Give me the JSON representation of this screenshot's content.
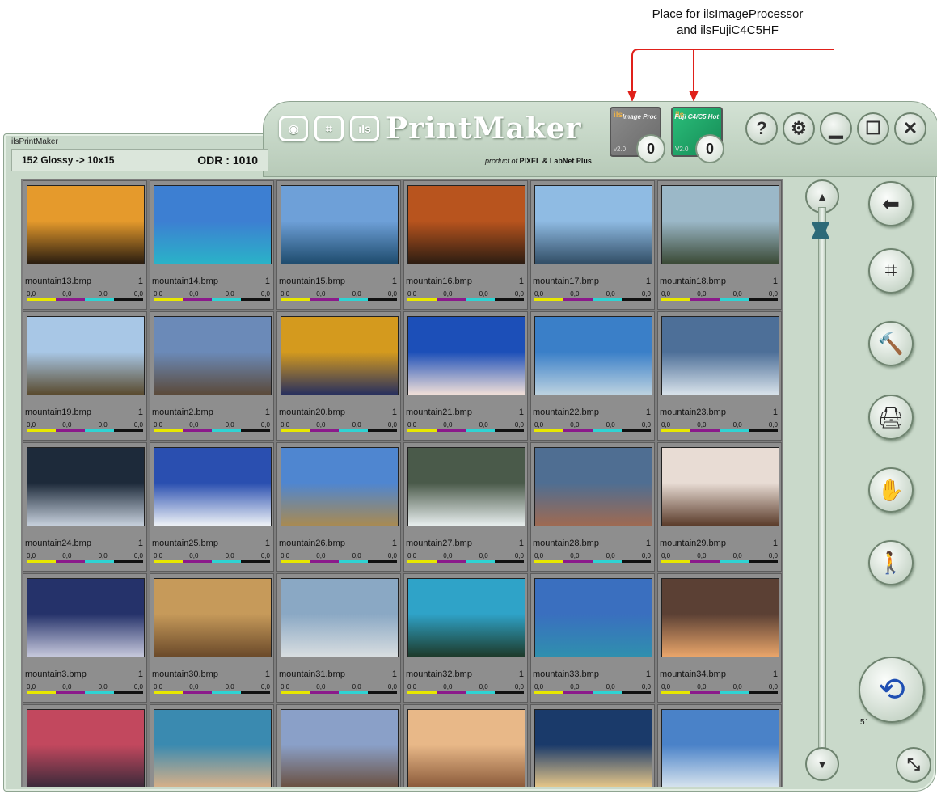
{
  "annotation": {
    "line1": "Place for ilsImageProcessor",
    "line2": "and ilsFujiC4C5HF",
    "arrow_color": "#e0201a"
  },
  "window": {
    "label": "ilsPrintMaker",
    "info_left": "152 Glossy -> 10x15",
    "info_right": "ODR : 1010"
  },
  "header": {
    "logo_box1": "◉",
    "logo_box2": "⌗",
    "logo_box3": "ils",
    "app_name": "PrintMaker",
    "credit_prefix": "product of",
    "credit_brands": "PIXEL & LabNet Plus"
  },
  "plugins": [
    {
      "tag": "ils",
      "name": "Image Proc",
      "version": "v2.0",
      "count": "0",
      "color": "#7a7a7a"
    },
    {
      "tag": "ils",
      "name": "Fuji C4/C5 Hot",
      "version": "V2.0",
      "count": "0",
      "color": "#1fa767"
    }
  ],
  "title_buttons": [
    {
      "name": "help-button",
      "glyph": "?"
    },
    {
      "name": "settings-button",
      "glyph": "⚙"
    },
    {
      "name": "minimize-button",
      "glyph": "▁"
    },
    {
      "name": "maximize-button",
      "glyph": "☐"
    },
    {
      "name": "close-button",
      "glyph": "✕"
    }
  ],
  "side_tools": [
    {
      "name": "back-button",
      "icon": "back-arrow-icon",
      "glyph": "⬅"
    },
    {
      "name": "crop-button",
      "icon": "crop-icon",
      "glyph": "⌗"
    },
    {
      "name": "tools-button",
      "icon": "hammer-icon",
      "glyph": "🔨"
    },
    {
      "name": "printer-button",
      "icon": "printer-icon",
      "glyph": "🖨"
    },
    {
      "name": "color-button",
      "icon": "color-hand-icon",
      "glyph": "✋"
    },
    {
      "name": "walk-button",
      "icon": "person-walking-icon",
      "glyph": "🚶"
    }
  ],
  "print_queue": {
    "count": "51",
    "glyph": "⟲"
  },
  "resize_glyph": "⤡",
  "scroll": {
    "up": "▲",
    "down": "▼"
  },
  "cell_defaults": {
    "qty": "1",
    "corrections": [
      "0,0",
      "0,0",
      "0,0",
      "0,0"
    ],
    "bar_colors": [
      "#e8e800",
      "#8b1a8b",
      "#2fd3d3",
      "#111111"
    ]
  },
  "thumbnails": [
    {
      "name": "mountain13.bmp",
      "qty": "1",
      "c1": "#e59a2c",
      "c2": "#2a1d10"
    },
    {
      "name": "mountain14.bmp",
      "qty": "1",
      "c1": "#3d7fd2",
      "c2": "#2ab2c8"
    },
    {
      "name": "mountain15.bmp",
      "qty": "1",
      "c1": "#6ea0d8",
      "c2": "#1f4c6e"
    },
    {
      "name": "mountain16.bmp",
      "qty": "1",
      "c1": "#b8541e",
      "c2": "#2d1d12"
    },
    {
      "name": "mountain17.bmp",
      "qty": "1",
      "c1": "#8fbbe3",
      "c2": "#324e66"
    },
    {
      "name": "mountain18.bmp",
      "qty": "1",
      "c1": "#9bb8c8",
      "c2": "#3b4a36"
    },
    {
      "name": "mountain19.bmp",
      "qty": "1",
      "c1": "#a8c7e6",
      "c2": "#5a4b2f"
    },
    {
      "name": "mountain2.bmp",
      "qty": "1",
      "c1": "#6b8ab8",
      "c2": "#5b4a3a"
    },
    {
      "name": "mountain20.bmp",
      "qty": "1",
      "c1": "#d49a1e",
      "c2": "#28305e"
    },
    {
      "name": "mountain21.bmp",
      "qty": "1",
      "c1": "#1c4fb8",
      "c2": "#f0dfd8"
    },
    {
      "name": "mountain22.bmp",
      "qty": "1",
      "c1": "#3a7fc8",
      "c2": "#bcd2e0"
    },
    {
      "name": "mountain23.bmp",
      "qty": "1",
      "c1": "#4d6f98",
      "c2": "#d8e2ea"
    },
    {
      "name": "mountain24.bmp",
      "qty": "1",
      "c1": "#1d2a3a",
      "c2": "#c6d0dc"
    },
    {
      "name": "mountain25.bmp",
      "qty": "1",
      "c1": "#2a4fb0",
      "c2": "#eef2f6"
    },
    {
      "name": "mountain26.bmp",
      "qty": "1",
      "c1": "#4f86d0",
      "c2": "#a88a52"
    },
    {
      "name": "mountain27.bmp",
      "qty": "1",
      "c1": "#4a5a4a",
      "c2": "#e8eeee"
    },
    {
      "name": "mountain28.bmp",
      "qty": "1",
      "c1": "#4f6e92",
      "c2": "#9e6a52"
    },
    {
      "name": "mountain29.bmp",
      "qty": "1",
      "c1": "#e8dcd4",
      "c2": "#5b3c2b"
    },
    {
      "name": "mountain3.bmp",
      "qty": "1",
      "c1": "#25326a",
      "c2": "#c6c8dc"
    },
    {
      "name": "mountain30.bmp",
      "qty": "1",
      "c1": "#c69a5a",
      "c2": "#6b4a2a"
    },
    {
      "name": "mountain31.bmp",
      "qty": "1",
      "c1": "#8aa8c4",
      "c2": "#d8dde0"
    },
    {
      "name": "mountain32.bmp",
      "qty": "1",
      "c1": "#2fa3c8",
      "c2": "#1d3a2a"
    },
    {
      "name": "mountain33.bmp",
      "qty": "1",
      "c1": "#3a6fbf",
      "c2": "#2f8fae"
    },
    {
      "name": "mountain34.bmp",
      "qty": "1",
      "c1": "#5b4034",
      "c2": "#e9a56a"
    },
    {
      "name": "",
      "qty": "",
      "c1": "#c2485e",
      "c2": "#3a2a3a"
    },
    {
      "name": "",
      "qty": "",
      "c1": "#3a8ab0",
      "c2": "#d8b088"
    },
    {
      "name": "",
      "qty": "",
      "c1": "#8aa0c8",
      "c2": "#6a5040"
    },
    {
      "name": "",
      "qty": "",
      "c1": "#e8b888",
      "c2": "#8a5a3a"
    },
    {
      "name": "",
      "qty": "",
      "c1": "#1a3a6a",
      "c2": "#e8c888"
    },
    {
      "name": "",
      "qty": "",
      "c1": "#4a82c8",
      "c2": "#d8e4ee"
    }
  ]
}
